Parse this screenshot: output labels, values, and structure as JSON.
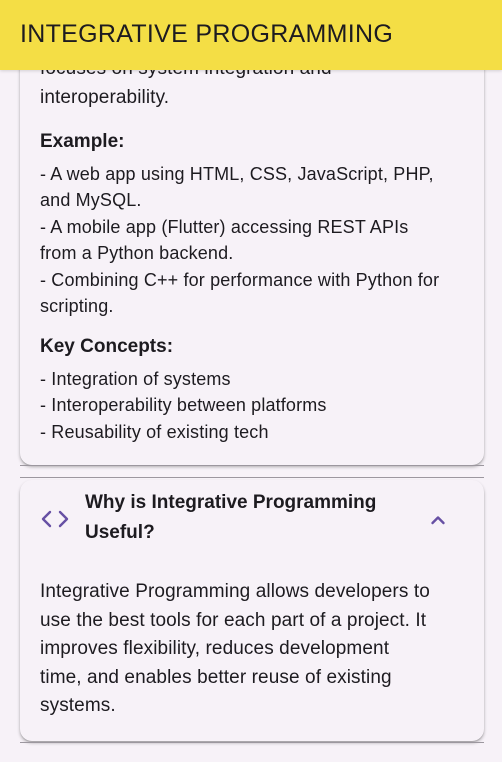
{
  "app_bar": {
    "title": "INTEGRATIVE PROGRAMMING"
  },
  "section1": {
    "intro_lines": [
      "focuses on system integration and",
      "interoperability."
    ],
    "example_heading": "Example:",
    "example_lines": [
      "- A web app using HTML, CSS, JavaScript, PHP,",
      "and MySQL.",
      "- A mobile app (Flutter) accessing REST APIs",
      "from a Python backend.",
      "- Combining C++ for performance with Python for",
      "scripting."
    ],
    "key_heading": "Key Concepts:",
    "key_lines": [
      "- Integration of systems",
      "- Interoperability between platforms",
      "- Reusability of existing tech"
    ]
  },
  "section2": {
    "icon": "code-icon",
    "title_lines": [
      "Why is Integrative Programming",
      "Useful?"
    ],
    "expanded": true,
    "body_lines": [
      "Integrative Programming allows developers to",
      "use the best tools for each part of a project. It",
      "improves flexibility, reduces development",
      "time, and enables better reuse of existing",
      "systems."
    ]
  },
  "colors": {
    "app_bar": "#f4de45",
    "background": "#f7f2f8",
    "accent": "#6750a4",
    "text": "#1d1b20"
  }
}
